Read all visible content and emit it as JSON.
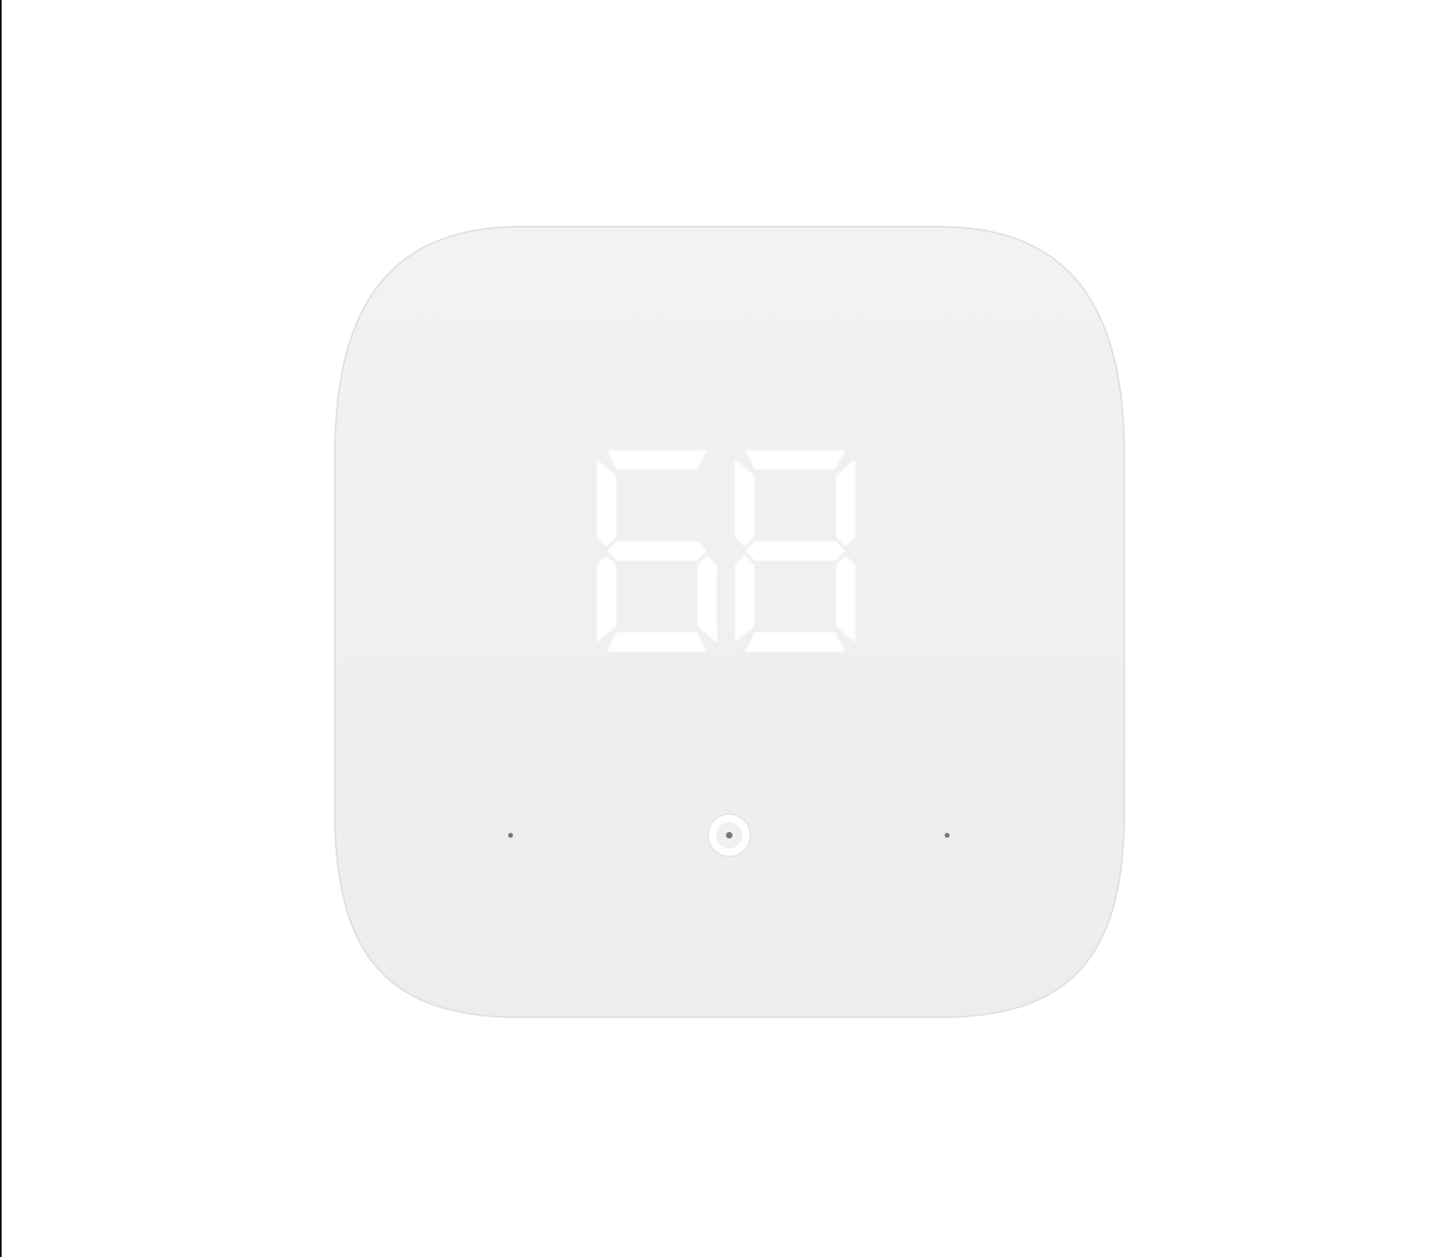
{
  "device": {
    "display_value": "68",
    "body_color": "#efefef",
    "segment_color": "#ffffff",
    "icons": [
      "indicator-dot",
      "center-button-ring",
      "indicator-dot"
    ]
  }
}
